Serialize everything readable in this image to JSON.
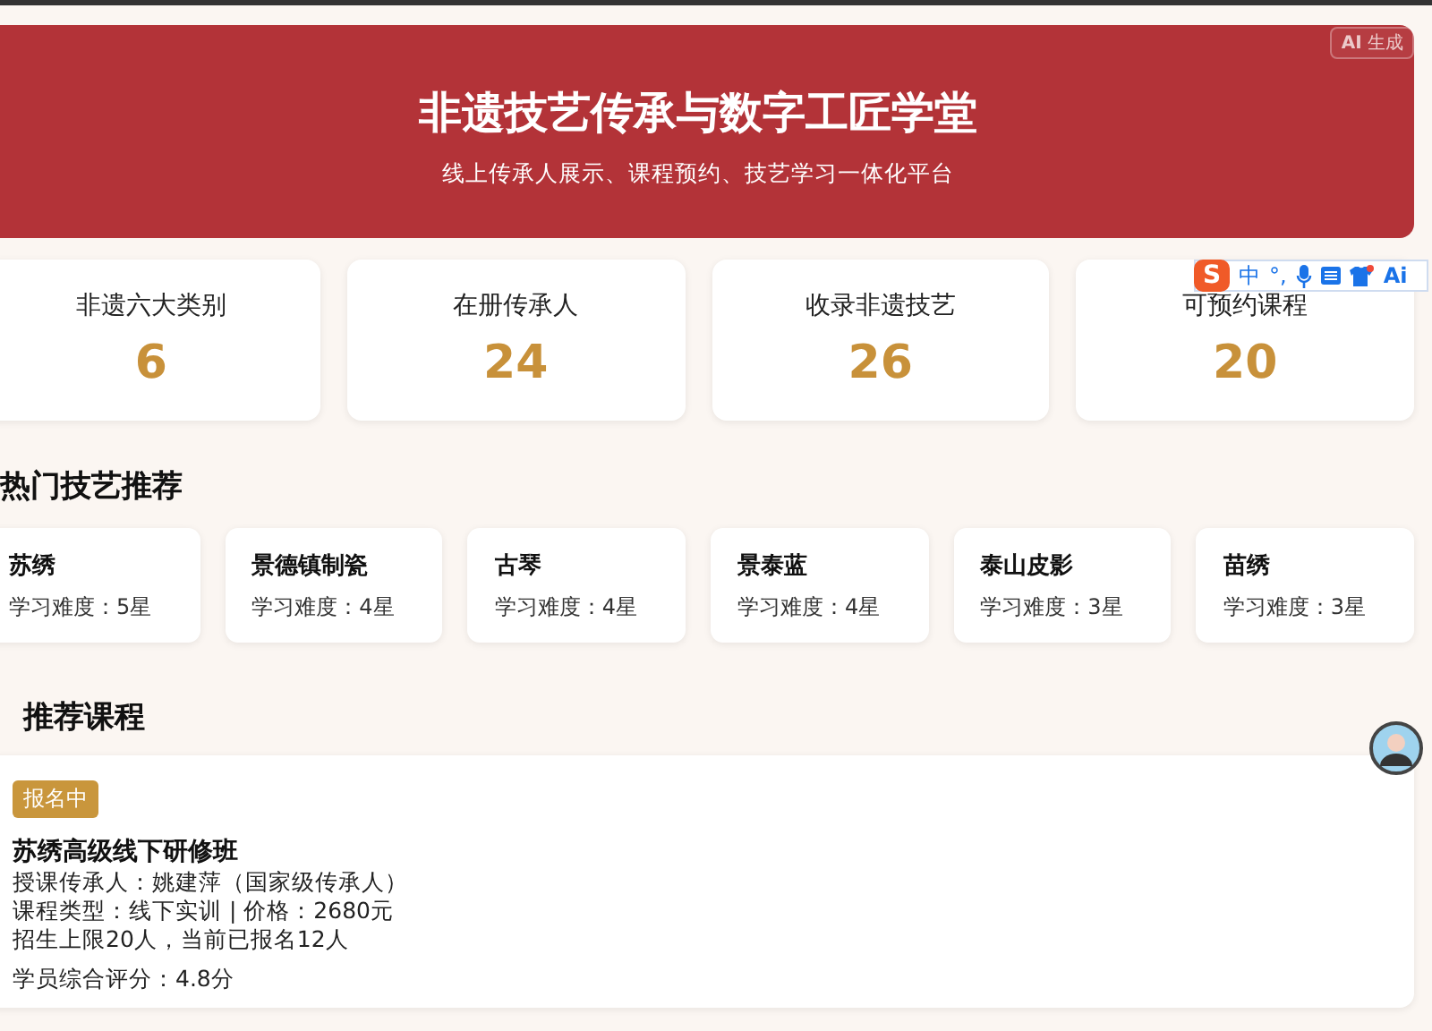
{
  "ai_badge": "**AI** 生成",
  "hero": {
    "title": "非遗技艺传承与数字工匠学堂",
    "subtitle": "线上传承人展示、课程预约、技艺学习一体化平台"
  },
  "stats": [
    {
      "label": "非遗六大类别",
      "value": "6"
    },
    {
      "label": "在册传承人",
      "value": "24"
    },
    {
      "label": "收录非遗技艺",
      "value": "26"
    },
    {
      "label": "可预约课程",
      "value": "20"
    }
  ],
  "hot_skills": {
    "title": "热门技艺推荐",
    "items": [
      {
        "name": "苏绣",
        "difficulty": "学习难度：5星"
      },
      {
        "name": "景德镇制瓷",
        "difficulty": "学习难度：4星"
      },
      {
        "name": "古琴",
        "difficulty": "学习难度：4星"
      },
      {
        "name": "景泰蓝",
        "difficulty": "学习难度：4星"
      },
      {
        "name": "泰山皮影",
        "difficulty": "学习难度：3星"
      },
      {
        "name": "苗绣",
        "difficulty": "学习难度：3星"
      }
    ]
  },
  "courses": {
    "title": "推荐课程",
    "items": [
      {
        "status": "报名中",
        "name": "苏绣高级线下研修班",
        "teacher": "授课传承人：姚建萍（国家级传承人）",
        "type_price": "课程类型：线下实训 | 价格：2680元",
        "enrollment": "招生上限20人，当前已报名12人",
        "rating": "学员综合评分：4.8分"
      }
    ]
  },
  "ime_toolbar": {
    "logo": "S",
    "mode": "中",
    "punctuation": "°,",
    "ai": "Ai"
  }
}
